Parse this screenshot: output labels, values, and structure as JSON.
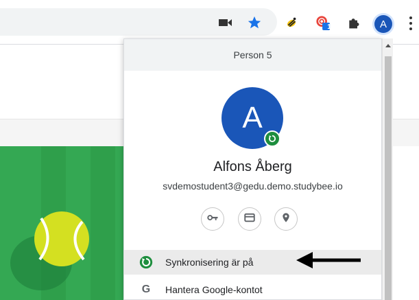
{
  "toolbar": {
    "extensions": [
      {
        "name": "video-camera-icon"
      },
      {
        "name": "bookmark-star-icon",
        "color": "#1a73e8"
      },
      {
        "name": "studybee-bee-icon"
      },
      {
        "name": "extension-badge-icon",
        "badge": "1"
      },
      {
        "name": "puzzle-piece-icon"
      }
    ],
    "profile_initial": "A",
    "menu_icon": "kebab-menu-icon"
  },
  "profile_menu": {
    "header_label": "Person 5",
    "avatar_initial": "A",
    "avatar_color": "#1a56b8",
    "name": "Alfons Åberg",
    "email": "svdemostudent3@gedu.demo.studybee.io",
    "quick_actions": [
      "key-icon",
      "credit-card-icon",
      "location-pin-icon"
    ],
    "items": [
      {
        "label": "Synkronisering är på",
        "icon": "sync-icon",
        "active": true
      },
      {
        "label": "Hantera Google-kontot",
        "icon": "google-g-icon"
      }
    ],
    "google_letter": "G"
  },
  "colors": {
    "accent": "#1a56b8",
    "sync_green": "#1e8e3e",
    "page_green": "#34a853"
  }
}
